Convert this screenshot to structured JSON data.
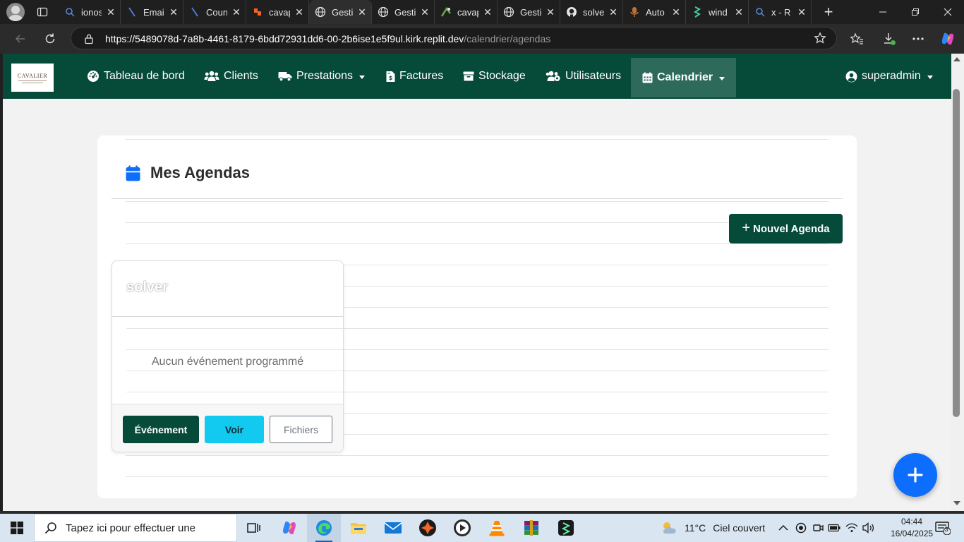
{
  "browser": {
    "tabs": [
      {
        "title": "ionos",
        "icon": "search-favicon"
      },
      {
        "title": "Email",
        "icon": "slash-favicon"
      },
      {
        "title": "Coun",
        "icon": "slash-favicon"
      },
      {
        "title": "cavap",
        "icon": "arrow-favicon"
      },
      {
        "title": "Gesti",
        "icon": "globe-favicon",
        "active": true
      },
      {
        "title": "Gesti",
        "icon": "globe-favicon"
      },
      {
        "title": "cavap",
        "icon": "replit-favicon"
      },
      {
        "title": "Gesti",
        "icon": "globe-favicon"
      },
      {
        "title": "solve",
        "icon": "github-favicon"
      },
      {
        "title": "Auto",
        "icon": "mic-favicon"
      },
      {
        "title": "wind",
        "icon": "leaf-favicon"
      },
      {
        "title": "x - R",
        "icon": "search-favicon"
      }
    ],
    "url_host": "https://5489078d-7a8b-4461-8179-6bdd72931dd6-00-2b6ise1e5f9ul.kirk.replit.dev",
    "url_path": "/calendrier/agendas"
  },
  "app": {
    "logo_text": "CAVALIER",
    "nav": [
      {
        "label": "Tableau de bord",
        "icon": "gauge-icon"
      },
      {
        "label": "Clients",
        "icon": "users-icon"
      },
      {
        "label": "Prestations",
        "icon": "truck-icon",
        "dropdown": true
      },
      {
        "label": "Factures",
        "icon": "invoice-icon"
      },
      {
        "label": "Stockage",
        "icon": "box-icon"
      },
      {
        "label": "Utilisateurs",
        "icon": "users-cog-icon"
      },
      {
        "label": "Calendrier",
        "icon": "calendar-icon",
        "dropdown": true,
        "active": true
      }
    ],
    "user": "superadmin"
  },
  "page": {
    "title": "Mes Agendas",
    "new_button": "Nouvel Agenda",
    "agenda": {
      "name": "solver",
      "empty_text": "Aucun événement programmé",
      "btn_event": "Événement",
      "btn_view": "Voir",
      "btn_files": "Fichiers"
    }
  },
  "taskbar": {
    "search_placeholder": "Tapez ici pour effectuer une",
    "weather_temp": "11°C",
    "weather_text": "Ciel couvert",
    "time": "04:44",
    "date": "16/04/2025",
    "notifications": "3"
  },
  "colors": {
    "primary": "#064a3a",
    "info": "#12caf0",
    "fab": "#0d6efd",
    "calendar_icon": "#0d6efd"
  }
}
